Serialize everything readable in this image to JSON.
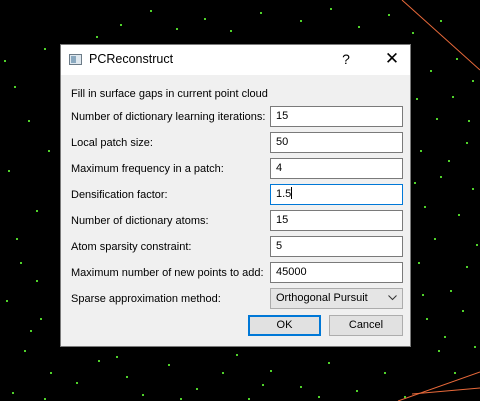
{
  "dialog": {
    "title": "PCReconstruct",
    "help_label": "?",
    "close_label": "✕",
    "description": "Fill in surface gaps in current point cloud"
  },
  "fields": [
    {
      "label": "Number of dictionary learning iterations:",
      "value": "15"
    },
    {
      "label": "Local patch size:",
      "value": "50"
    },
    {
      "label": "Maximum frequency in a patch:",
      "value": "4"
    },
    {
      "label": "Densification factor:",
      "value": "1.5"
    },
    {
      "label": "Number of dictionary atoms:",
      "value": "15"
    },
    {
      "label": "Atom sparsity constraint:",
      "value": "5"
    },
    {
      "label": "Maximum number of new points to add:",
      "value": "45000"
    }
  ],
  "method": {
    "label": "Sparse approximation method:",
    "selected": "Orthogonal Pursuit"
  },
  "buttons": {
    "ok": "OK",
    "cancel": "Cancel"
  },
  "colors": {
    "point": "#4fd12a",
    "line": "#e8693a",
    "focus": "#0078d7"
  },
  "icons": [
    "app-icon",
    "help-icon",
    "close-icon",
    "chevron-down-icon"
  ]
}
